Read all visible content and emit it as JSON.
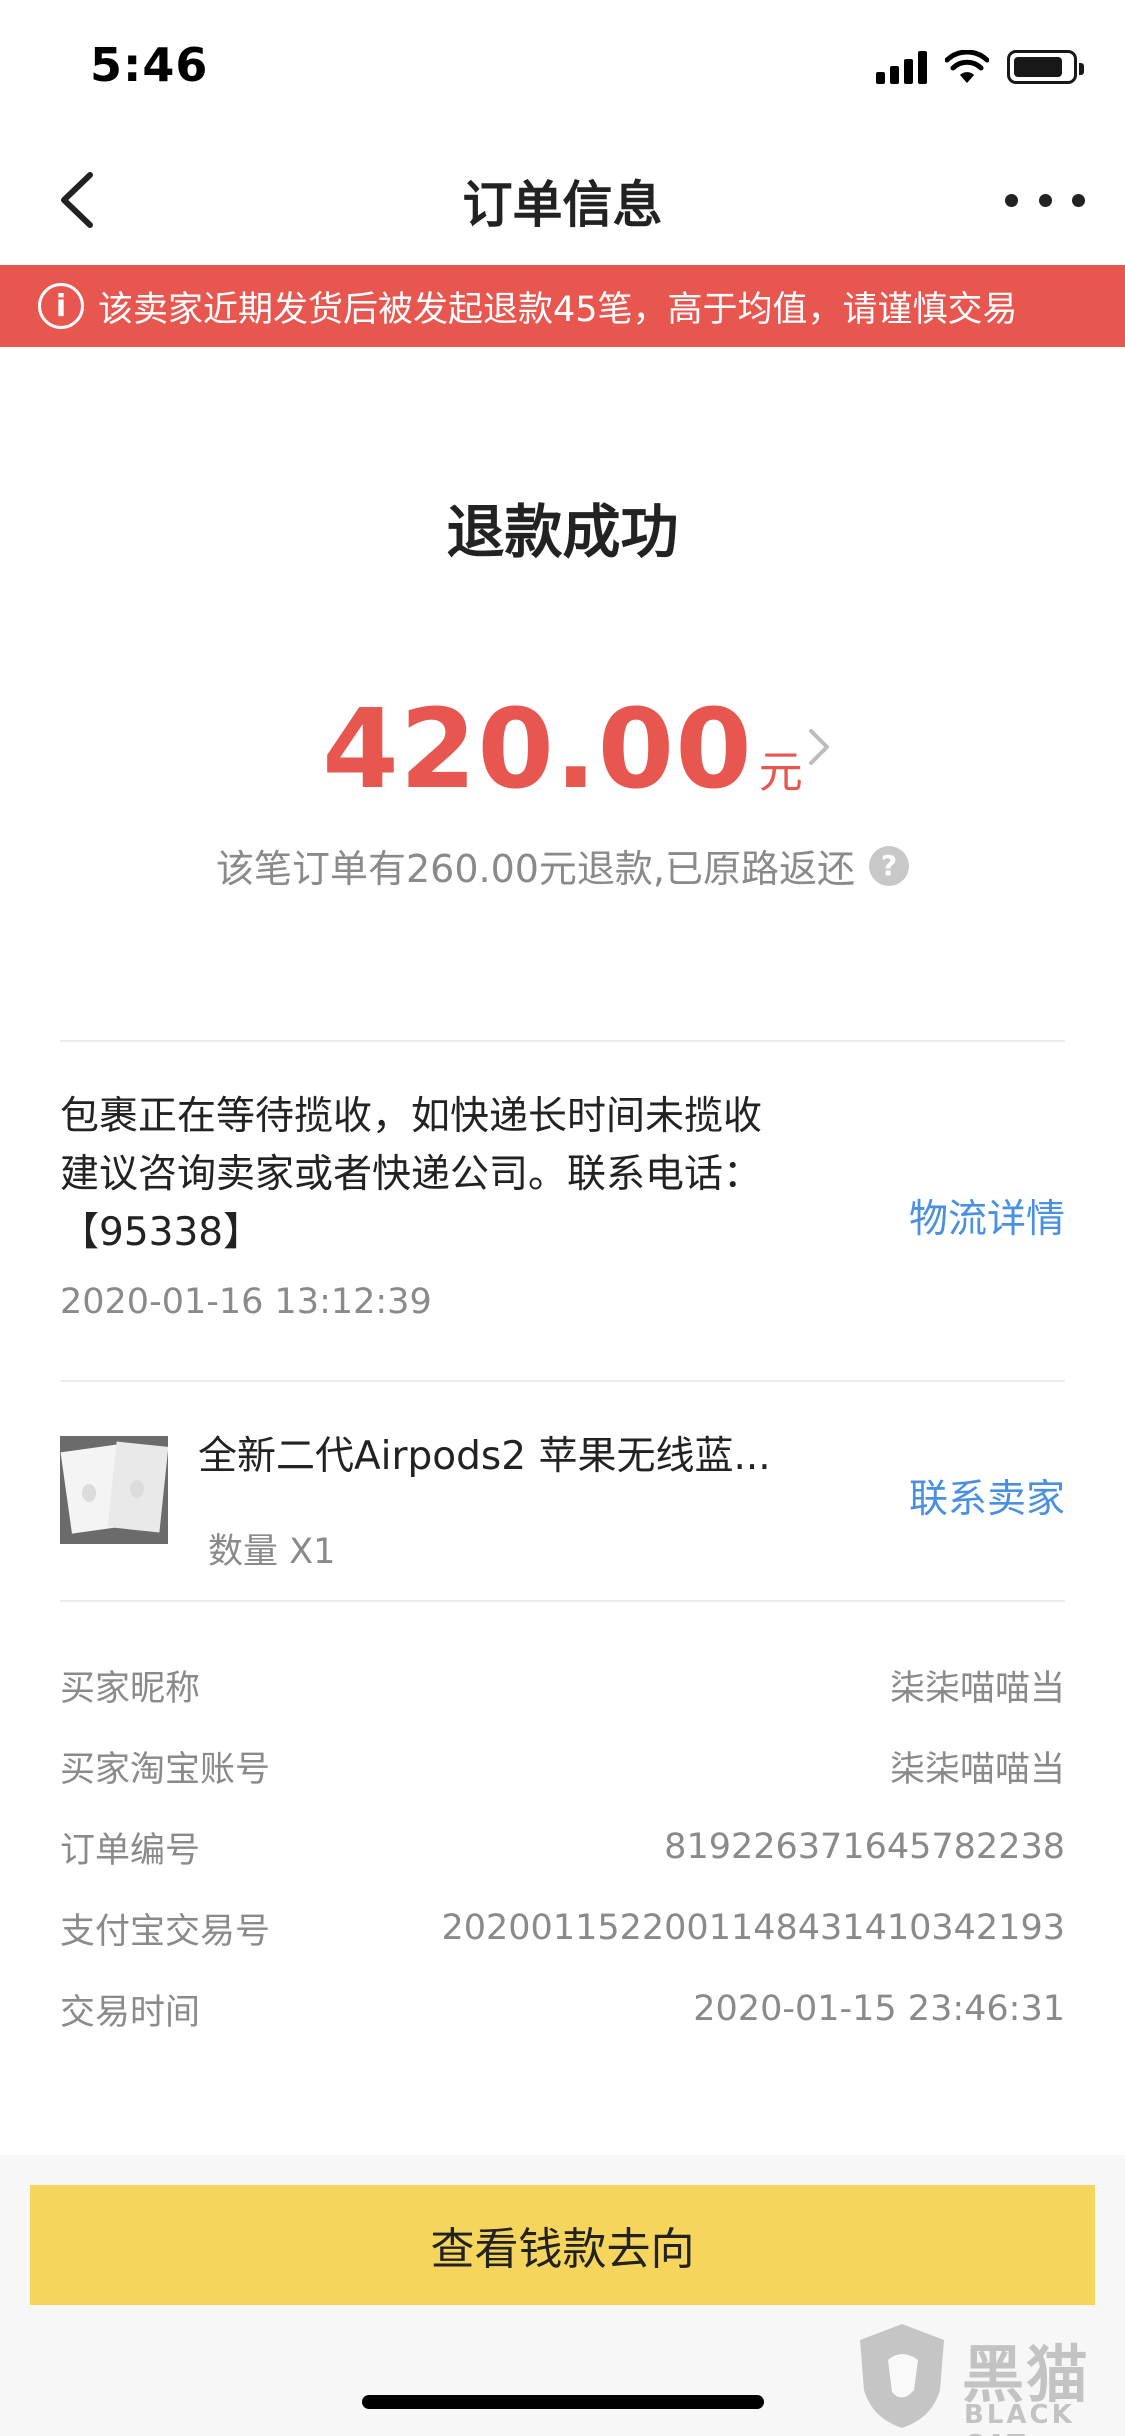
{
  "status_bar": {
    "time": "5:46",
    "icons": [
      "cellular-signal-icon",
      "wifi-icon",
      "battery-icon"
    ]
  },
  "nav": {
    "title": "订单信息",
    "back_icon": "chevron-left-icon",
    "more_icon": "more-dots-icon"
  },
  "warning_banner": {
    "text": "该卖家近期发货后被发起退款45笔，高于均值，请谨慎交易",
    "icon": "info-circle-icon",
    "color": "#e8574f"
  },
  "order_status": {
    "title": "退款成功",
    "amount": "420.00",
    "amount_unit": "元",
    "note": "该笔订单有260.00元退款,已原路返还",
    "help_icon": "question-circle-icon",
    "accent_color": "#e8574f"
  },
  "logistics": {
    "message": "包裹正在等待揽收，如快递长时间未揽收建议咨询卖家或者快递公司。联系电话：【95338】",
    "time": "2020-01-16 13:12:39",
    "link": "物流详情",
    "link_color": "#4a90e2"
  },
  "product": {
    "title": "全新二代Airpods2 苹果无线蓝...",
    "quantity": "数量 X1",
    "contact_link": "联系卖家"
  },
  "info": [
    {
      "label": "买家昵称",
      "value": "柒柒喵喵当"
    },
    {
      "label": "买家淘宝账号",
      "value": "柒柒喵喵当"
    },
    {
      "label": "订单编号",
      "value": "819226371645782238"
    },
    {
      "label": "支付宝交易号",
      "value": "2020011522001148431410342193"
    },
    {
      "label": "交易时间",
      "value": "2020-01-15 23:46:31"
    }
  ],
  "bottom": {
    "button_label": "查看钱款去向",
    "button_color": "#f6d55c"
  },
  "watermark": {
    "cn": "黑猫",
    "en": "BLACK CAT"
  }
}
